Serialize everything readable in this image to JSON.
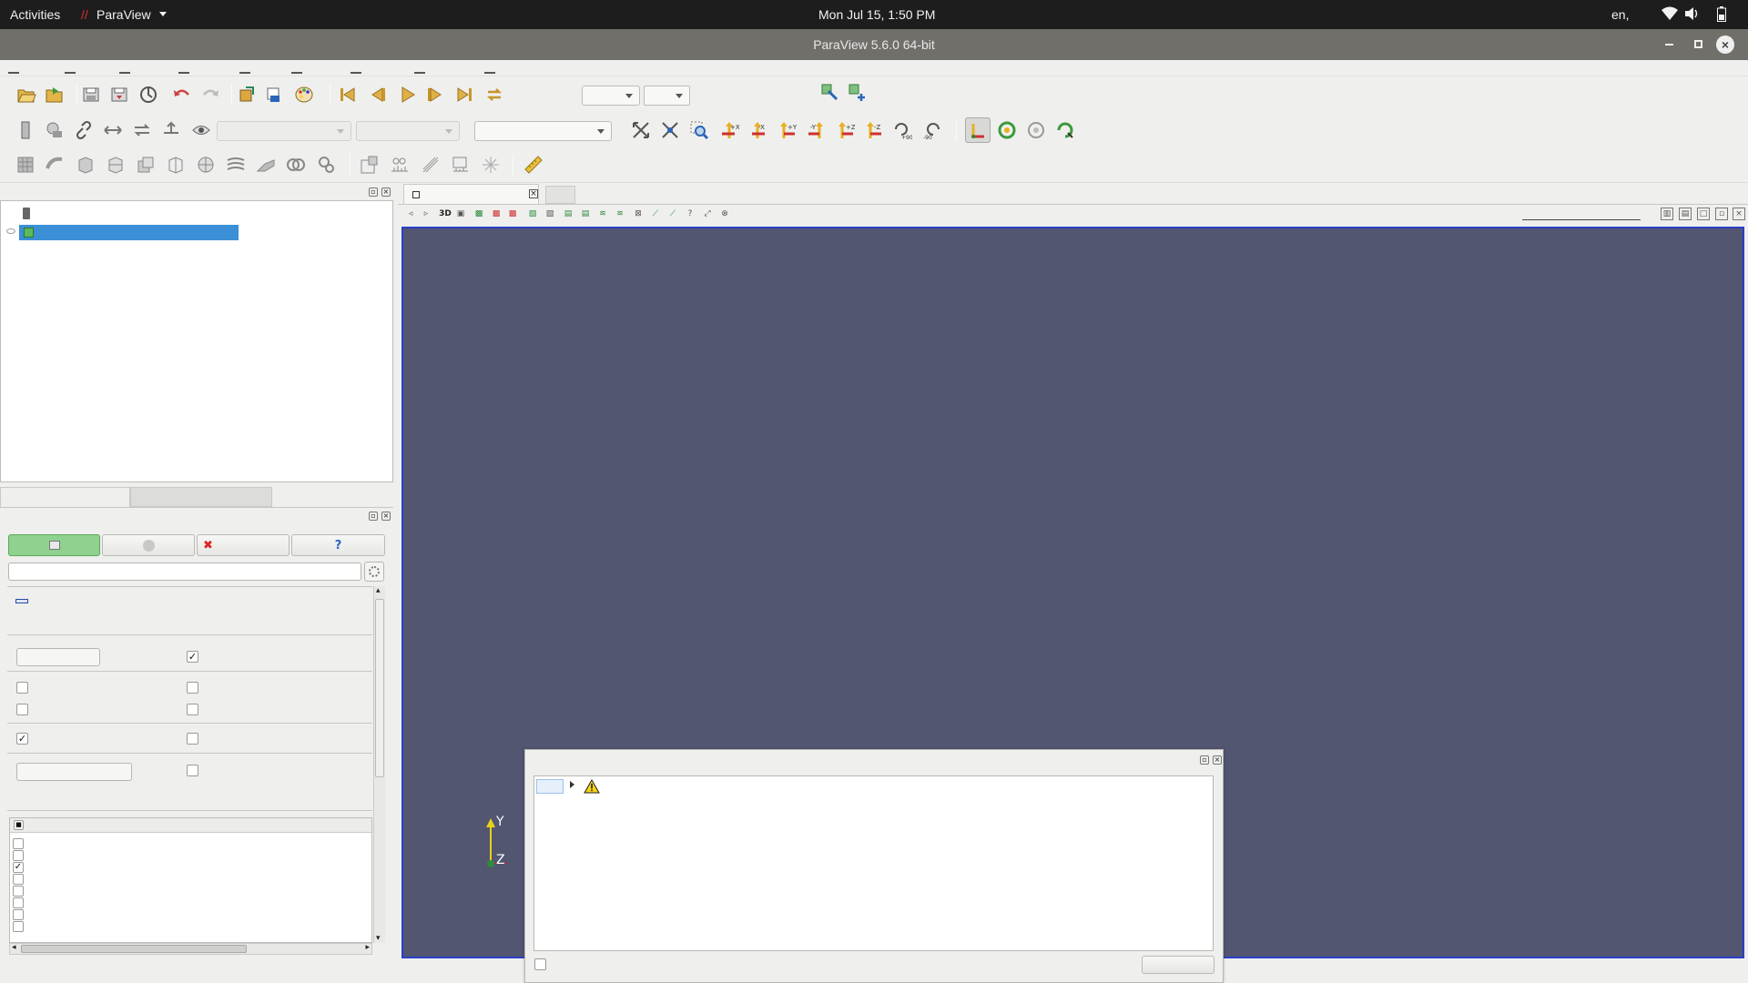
{
  "system_bar": {
    "activities": "Activities",
    "app_menu": "ParaView",
    "clock": "Mon Jul 15,  1:50 PM",
    "input_method": "en,"
  },
  "window": {
    "title": "ParaView 5.6.0 64-bit"
  },
  "render_view": {
    "toolbar_3d_label": "3D",
    "background_color": "#525670",
    "axes_y_label": "Y",
    "axes_z_label": "Z"
  },
  "colors": {
    "selection": "#3a8fd6",
    "apply_button": "#8fd18f",
    "view_border": "#2a3fc9",
    "axis_y": "#e6d21a",
    "axis_origin": "#2e8b3e",
    "axis_x": "#d02020"
  },
  "icons": {
    "main_toolbar": [
      "open-icon",
      "load-state-icon",
      "save-data-icon",
      "save-state-icon",
      "connect-icon",
      "undo-icon",
      "redo-icon",
      "reset-session-icon",
      "find-data-icon",
      "color-palette-icon"
    ],
    "vcr_toolbar": [
      "first-frame-icon",
      "previous-frame-icon",
      "play-icon",
      "next-frame-icon",
      "last-frame-icon",
      "loop-icon"
    ],
    "camera_toolbar": [
      "reset-camera-icon",
      "zoom-to-data-icon",
      "zoom-to-box-icon",
      "view-plus-x-icon",
      "view-minus-x-icon",
      "view-plus-y-icon",
      "view-minus-y-icon",
      "view-plus-z-icon",
      "view-minus-z-icon",
      "rotate-plus-90-icon",
      "rotate-minus-90-icon"
    ],
    "filters_toolbar": [
      "calculator-icon",
      "contour-icon",
      "clip-icon",
      "slice-icon",
      "threshold-icon",
      "extract-subset-icon",
      "glyph-icon",
      "stream-tracer-icon",
      "warp-icon",
      "group-icon",
      "extract-level-icon"
    ],
    "properties_buttons": [
      "apply-icon",
      "reset-icon",
      "delete-icon",
      "help-icon"
    ],
    "output_messages": [
      "warning-icon"
    ]
  }
}
